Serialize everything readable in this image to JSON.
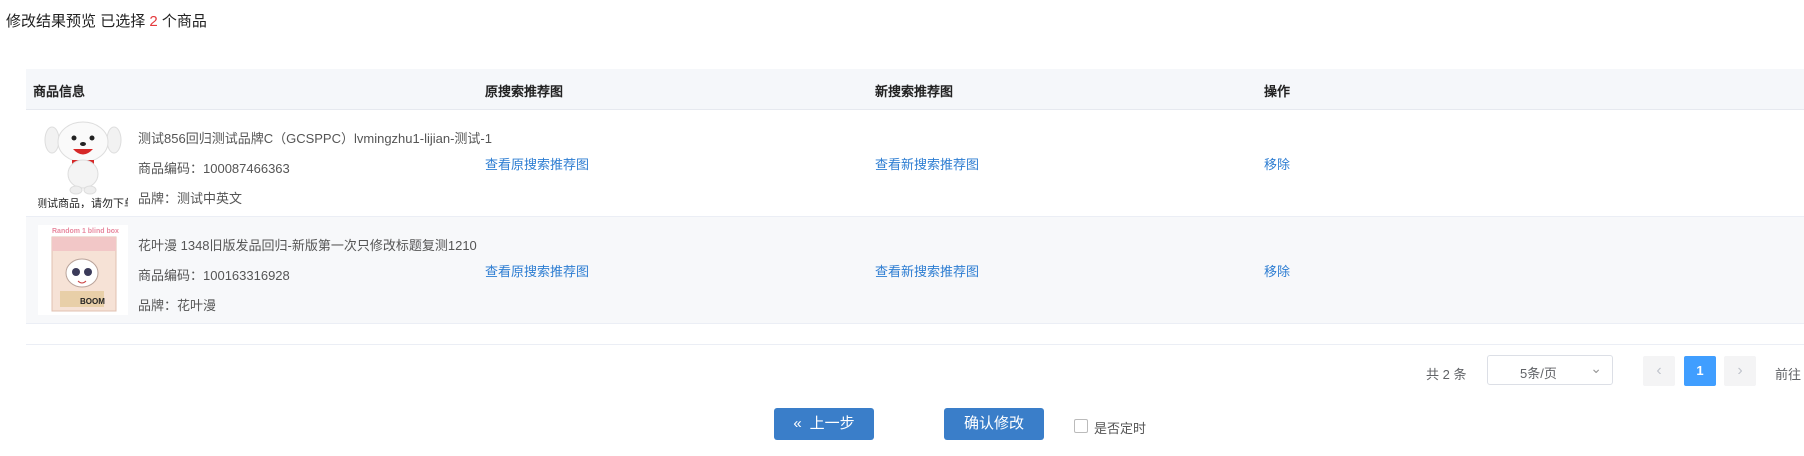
{
  "header": {
    "title": "修改结果预览",
    "selected_prefix": "已选择",
    "selected_count": "2",
    "selected_suffix": "个商品"
  },
  "table": {
    "columns": [
      "商品信息",
      "原搜索推荐图",
      "新搜索推荐图",
      "操作"
    ],
    "rows": [
      {
        "name": "测试856回归测试品牌C（GCSPPC）lvmingzhu1-lijian-测试-1",
        "code": "商品编码：100087466363",
        "brand": "品牌：测试中英文",
        "thumb_caption": "测试商品，请勿下单",
        "orig_link": "查看原搜索推荐图",
        "new_link": "查看新搜索推荐图",
        "action": "移除"
      },
      {
        "name": "花叶漫 1348旧版发品回归-新版第一次只修改标题复测1210",
        "code": "商品编码：100163316928",
        "brand": "品牌：花叶漫",
        "thumb_caption": "Random 1 blind box",
        "thumb_caption2": "BOOM",
        "orig_link": "查看原搜索推荐图",
        "new_link": "查看新搜索推荐图",
        "action": "移除"
      }
    ]
  },
  "pagination": {
    "total": "共 2 条",
    "page_size": "5条/页",
    "current_page": "1",
    "goto": "前往"
  },
  "actions": {
    "prev_label": "上一步",
    "confirm_label": "确认修改",
    "schedule_label": "是否定时"
  },
  "colors": {
    "accent": "#409eff",
    "link": "#2d7dd2",
    "button": "#3a7ec9",
    "count": "#e4393c"
  }
}
